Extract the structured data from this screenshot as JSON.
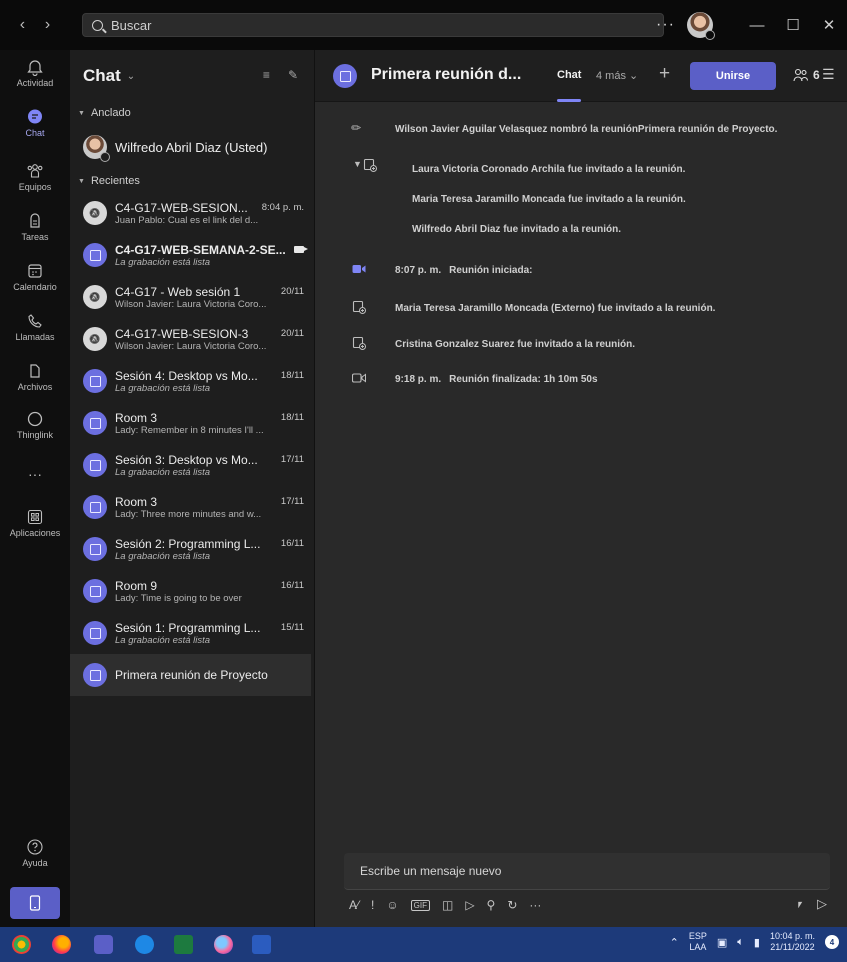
{
  "titlebar": {
    "back": "‹",
    "forward": "›",
    "search_placeholder": "Buscar",
    "more": "···",
    "minimize": "—",
    "maximize": "☐",
    "close": "✕"
  },
  "rail": [
    {
      "label": "Actividad",
      "icon": "bell-icon"
    },
    {
      "label": "Chat",
      "icon": "chat-icon",
      "active": true
    },
    {
      "label": "Equipos",
      "icon": "teams-icon"
    },
    {
      "label": "Tareas",
      "icon": "tasks-icon"
    },
    {
      "label": "Calendario",
      "icon": "calendar-icon"
    },
    {
      "label": "Llamadas",
      "icon": "phone-icon"
    },
    {
      "label": "Archivos",
      "icon": "file-icon"
    },
    {
      "label": "Thinglink",
      "icon": "circle-icon"
    },
    {
      "label": "···",
      "icon": "more-icon"
    },
    {
      "label": "Aplicaciones",
      "icon": "apps-icon"
    }
  ],
  "rail_help": "Ayuda",
  "chatlist": {
    "title": "Chat",
    "pinned_header": "Anclado",
    "recent_header": "Recientes",
    "pinned": [
      {
        "name": "Wilfredo Abril Diaz (Usted)"
      }
    ],
    "recent": [
      {
        "title": "C4-G17-WEB-SESION...",
        "time": "8:04 p. m.",
        "sub": "Juan Pablo: Cual es el link del d...",
        "avatar": "muted",
        "bold": false
      },
      {
        "title": "C4-G17-WEB-SEMANA-2-SE...",
        "time": "",
        "sub": "La grabación está lista",
        "avatar": "meet",
        "bold": true,
        "italic": true,
        "live": true
      },
      {
        "title": "C4-G17 - Web sesión 1",
        "time": "20/11",
        "sub": "Wilson Javier: Laura Victoria Coro...",
        "avatar": "muted"
      },
      {
        "title": "C4-G17-WEB-SESION-3",
        "time": "20/11",
        "sub": "Wilson Javier: Laura Victoria Coro...",
        "avatar": "muted"
      },
      {
        "title": "Sesión 4: Desktop vs Mo...",
        "time": "18/11",
        "sub": "La grabación está lista",
        "avatar": "meet",
        "italic": true
      },
      {
        "title": "Room 3",
        "time": "18/11",
        "sub": "Lady: Remember in 8 minutes I'll ...",
        "avatar": "meet"
      },
      {
        "title": "Sesión 3: Desktop vs Mo...",
        "time": "17/11",
        "sub": "La grabación está lista",
        "avatar": "meet",
        "italic": true
      },
      {
        "title": "Room 3",
        "time": "17/11",
        "sub": "Lady: Three more minutes and w...",
        "avatar": "meet"
      },
      {
        "title": "Sesión 2: Programming L...",
        "time": "16/11",
        "sub": "La grabación está lista",
        "avatar": "meet",
        "italic": true
      },
      {
        "title": "Room 9",
        "time": "16/11",
        "sub": "Lady: Time is going to be over",
        "avatar": "meet"
      },
      {
        "title": "Sesión 1: Programming L...",
        "time": "15/11",
        "sub": "La grabación está lista",
        "avatar": "meet",
        "italic": true
      },
      {
        "title": "Primera reunión de Proyecto",
        "time": "",
        "sub": "",
        "avatar": "meet",
        "selected": true
      }
    ]
  },
  "main": {
    "title": "Primera reunión d...",
    "tab_chat": "Chat",
    "tab_more": "4 más",
    "add": "+",
    "join": "Unirse",
    "participants": "6",
    "events": [
      {
        "icon": "pencil-icon",
        "time": "",
        "text": "Wilson Javier Aguilar Velasquez nombró la reuniónPrimera reunión de Proyecto."
      },
      {
        "icon": "add-person-icon",
        "time": "",
        "text": "Laura Victoria Coronado Archila fue invitado a la reunión."
      },
      {
        "icon": "",
        "time": "",
        "text": "Maria Teresa Jaramillo Moncada fue invitado a la reunión."
      },
      {
        "icon": "",
        "time": "",
        "text": "Wilfredo Abril Diaz fue invitado a la reunión."
      },
      {
        "icon": "video-icon",
        "time": "8:07 p. m.",
        "text": "Reunión iniciada:"
      },
      {
        "icon": "add-person-icon",
        "time": "",
        "text": "Maria Teresa Jaramillo Moncada (Externo) fue invitado a la reunión."
      },
      {
        "icon": "add-person-icon",
        "time": "",
        "text": "Cristina Gonzalez Suarez fue invitado a la reunión."
      },
      {
        "icon": "video-off-icon",
        "time": "9:18 p. m.",
        "text": "Reunión finalizada: 1h 10m 50s"
      }
    ],
    "compose_placeholder": "Escribe un mensaje nuevo"
  },
  "taskbar": {
    "lang_top": "ESP",
    "lang_bottom": "LAA",
    "time": "10:04 p. m.",
    "date": "21/11/2022",
    "notifications": "4"
  },
  "colors": {
    "accent": "#5b5fc7",
    "accent_light": "#7f85f5",
    "taskbar": "#1d3a7a"
  }
}
